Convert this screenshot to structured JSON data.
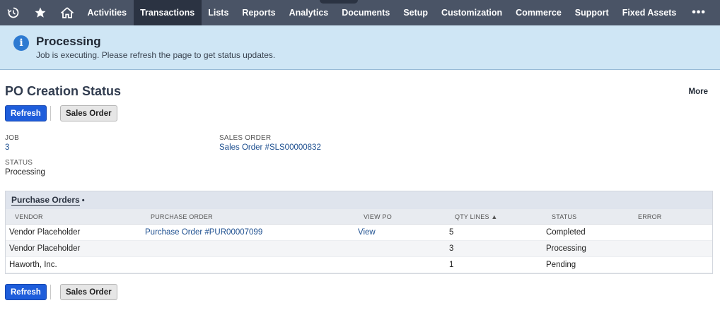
{
  "nav": {
    "icons": [
      "recent-records-icon",
      "star-icon",
      "home-icon"
    ],
    "items": [
      "Activities",
      "Transactions",
      "Lists",
      "Reports",
      "Analytics",
      "Documents",
      "Setup",
      "Customization",
      "Commerce",
      "Support",
      "Fixed Assets"
    ],
    "active": "Transactions",
    "more": "•••"
  },
  "banner": {
    "title": "Processing",
    "message": "Job is executing. Please refresh the page to get status updates.",
    "icon": "i"
  },
  "page": {
    "title": "PO Creation Status",
    "more": "More"
  },
  "buttons": {
    "refresh": "Refresh",
    "sales_order": "Sales Order"
  },
  "fields": {
    "job_label": "JOB",
    "job_value": "3",
    "sales_order_label": "SALES ORDER",
    "sales_order_value": "Sales Order #SLS00000832",
    "status_label": "STATUS",
    "status_value": "Processing"
  },
  "sublist": {
    "title": "Purchase Orders",
    "marker": "•",
    "columns": {
      "vendor": "VENDOR",
      "purchase_order": "PURCHASE ORDER",
      "view_po": "VIEW PO",
      "qty_lines": "QTY LINES ▲",
      "status": "STATUS",
      "error": "ERROR"
    },
    "rows": [
      {
        "vendor": "Vendor Placeholder",
        "purchase_order": "Purchase Order #PUR00007099",
        "view_po": "View",
        "qty_lines": "5",
        "status": "Completed",
        "error": ""
      },
      {
        "vendor": "Vendor Placeholder",
        "purchase_order": "",
        "view_po": "",
        "qty_lines": "3",
        "status": "Processing",
        "error": ""
      },
      {
        "vendor": "Haworth, Inc.",
        "purchase_order": "",
        "view_po": "",
        "qty_lines": "1",
        "status": "Pending",
        "error": ""
      }
    ]
  },
  "colors": {
    "nav_bg": "#4a5466",
    "nav_active": "#2b3342",
    "banner_bg": "#cfe6f5",
    "info_icon": "#2e7ad1",
    "primary_button": "#1e5ddb",
    "link": "#1c4e8f"
  }
}
